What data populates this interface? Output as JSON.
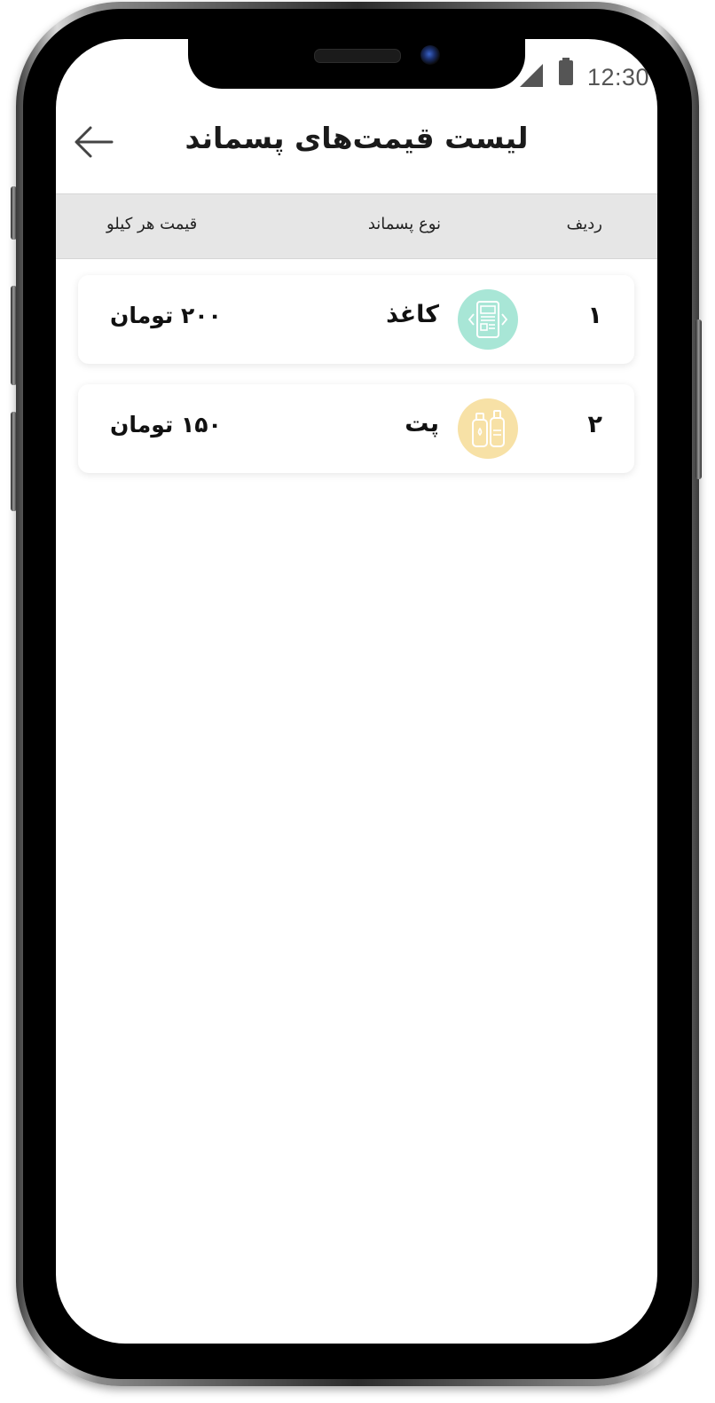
{
  "status_bar": {
    "time": "12:30"
  },
  "header": {
    "title": "لیست قیمت‌های پسماند",
    "back_icon": "arrow-left-icon"
  },
  "table": {
    "columns": {
      "index": "ردیف",
      "type": "نوع پسماند",
      "price": "قیمت هر کیلو"
    },
    "rows": [
      {
        "index": "۱",
        "type": "کاغذ",
        "price": "۲۰۰ تومان",
        "icon": "paper-icon",
        "icon_color": "#a8e6d6"
      },
      {
        "index": "۲",
        "type": "پت",
        "price": "۱۵۰ تومان",
        "icon": "plastic-bottles-icon",
        "icon_color": "#f7e1a6"
      }
    ]
  },
  "colors": {
    "header_bg": "#e6e6e6",
    "text": "#1a1a1a"
  }
}
